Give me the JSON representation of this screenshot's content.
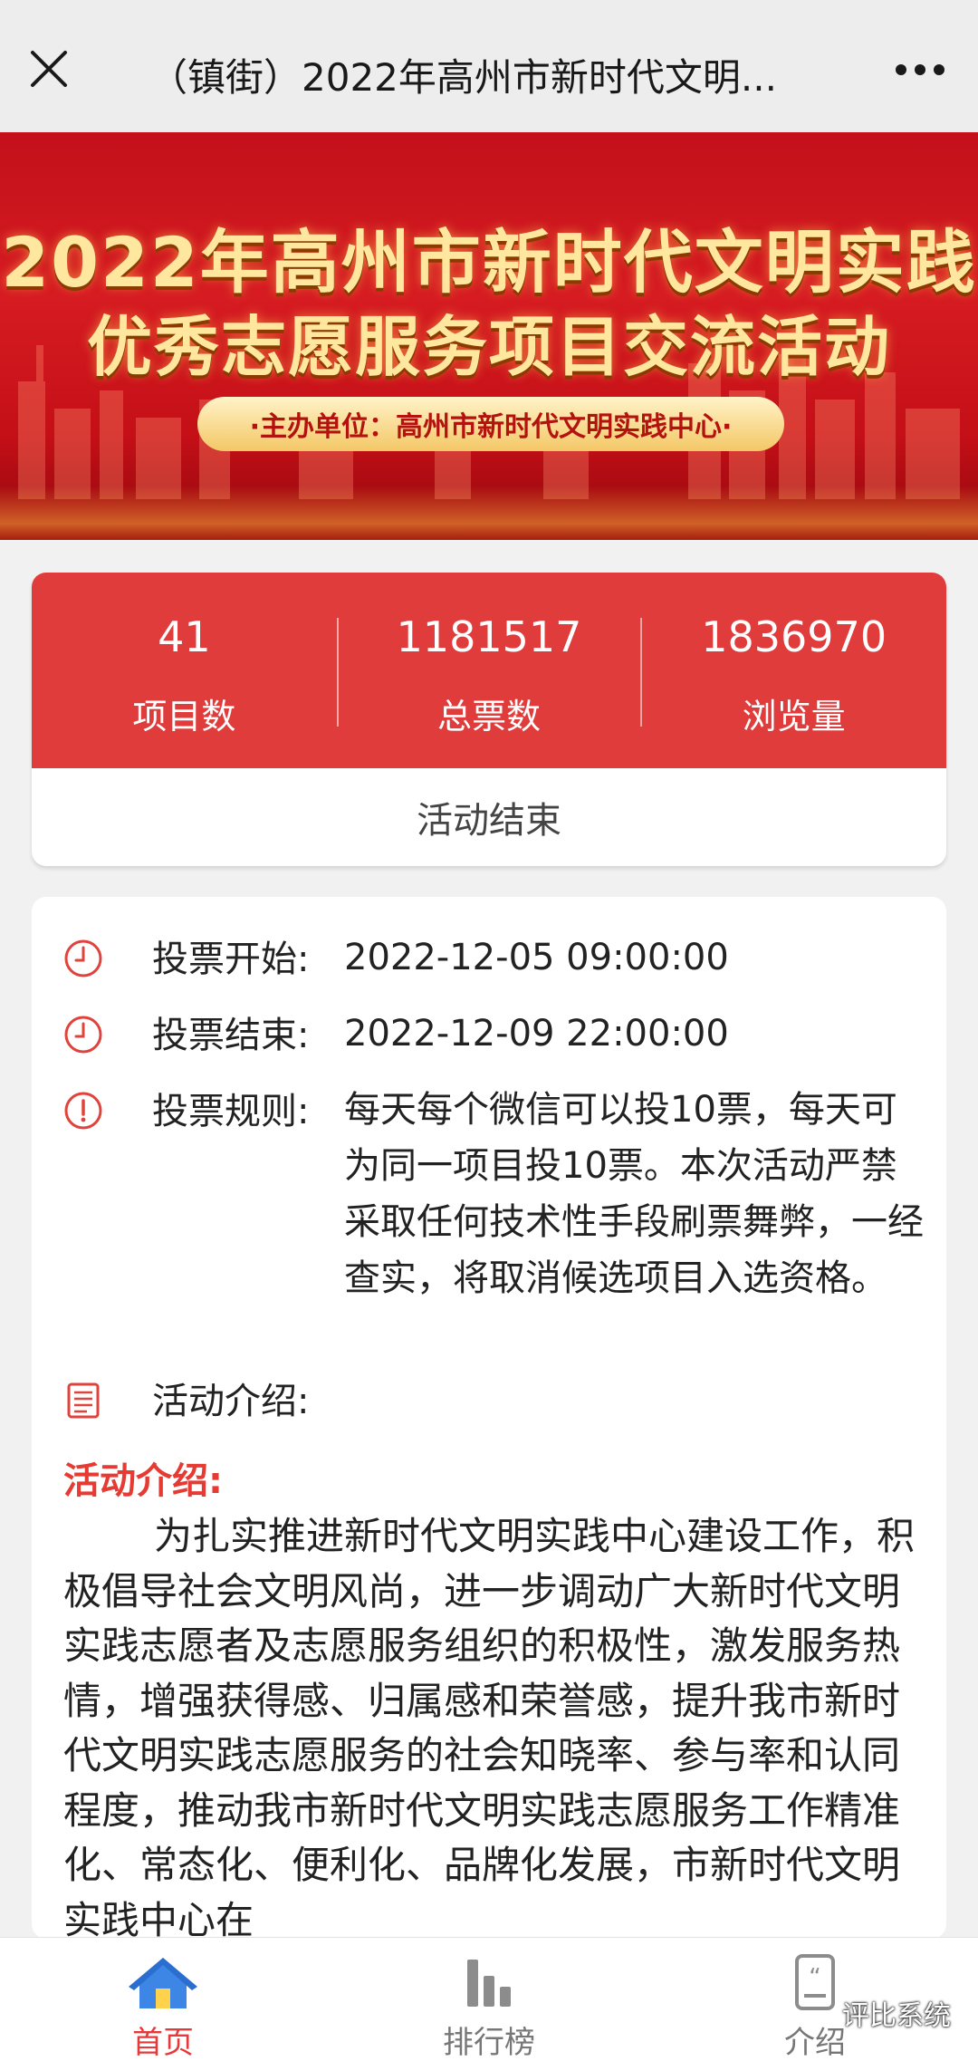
{
  "topbar": {
    "title": "（镇街）2022年高州市新时代文明..."
  },
  "banner": {
    "line1": "2022年高州市新时代文明实践",
    "line2": "优秀志愿服务项目交流活动",
    "organizer": "·主办单位：高州市新时代文明实践中心·"
  },
  "stats": {
    "items": [
      {
        "value": "41",
        "label": "项目数"
      },
      {
        "value": "1181517",
        "label": "总票数"
      },
      {
        "value": "1836970",
        "label": "浏览量"
      }
    ],
    "status": "活动结束"
  },
  "info": {
    "vote_start": {
      "icon": "clock-icon",
      "label": "投票开始:",
      "value": "2022-12-05 09:00:00"
    },
    "vote_end": {
      "icon": "clock-icon",
      "label": "投票结束:",
      "value": "2022-12-09 22:00:00"
    },
    "vote_rules": {
      "icon": "alert-icon",
      "label": "投票规则:",
      "value": "每天每个微信可以投10票，每天可为同一项目投10票。本次活动严禁采取任何技术性手段刷票舞弊，一经查实，将取消候选项目入选资格。"
    },
    "intro": {
      "icon": "document-icon",
      "label": "活动介绍:"
    },
    "intro_heading": "活动介绍:",
    "intro_text": "为扎实推进新时代文明实践中心建设工作，积极倡导社会文明风尚，进一步调动广大新时代文明实践志愿者及志愿服务组织的积极性，激发服务热情，增强获得感、归属感和荣誉感，提升我市新时代文明实践志愿服务的社会知晓率、参与率和认同程度，推动我市新时代文明实践志愿服务工作精准化、常态化、便利化、品牌化发展，市新时代文明实践中心在"
  },
  "bottomnav": {
    "tabs": [
      {
        "label": "首页",
        "icon": "home-icon",
        "active": true
      },
      {
        "label": "排行榜",
        "icon": "bar-chart-icon",
        "active": false
      },
      {
        "label": "介绍",
        "icon": "quote-card-icon",
        "active": false
      }
    ]
  },
  "watermark": "评比系统",
  "colors": {
    "accent_red": "#e03c3c",
    "heading_red": "#e53b33",
    "banner_red": "#c3101a"
  }
}
